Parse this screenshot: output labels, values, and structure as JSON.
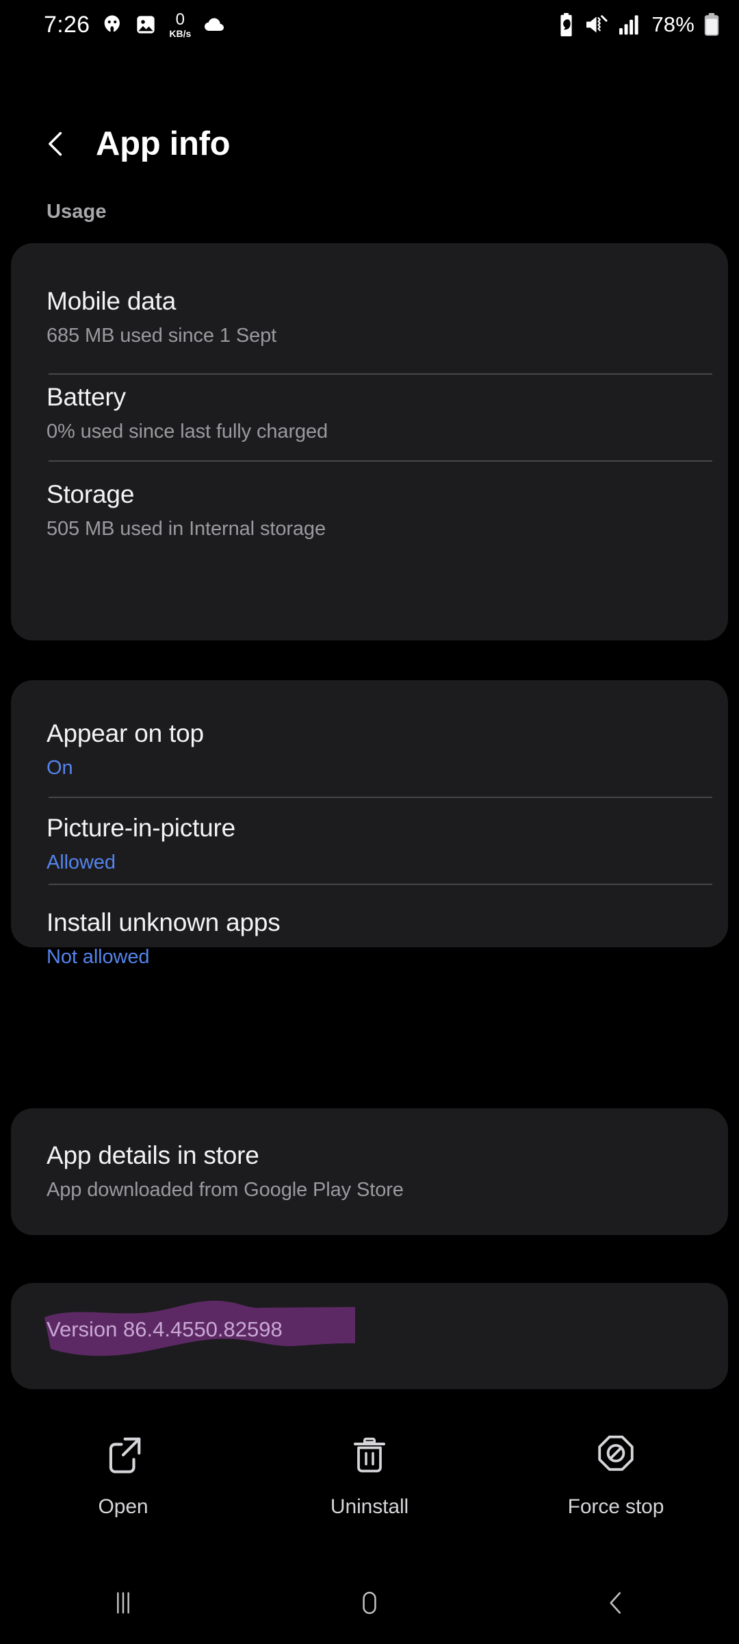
{
  "status_bar": {
    "time": "7:26",
    "network_speed_value": "0",
    "network_speed_unit": "KB/s",
    "battery_percent": "78%",
    "left_icons": [
      "malwarebytes-icon",
      "gallery-image-icon",
      "network-speed-indicator",
      "cloud-icon"
    ],
    "right_icons": [
      "battery-saver-icon",
      "mute-vibrate-icon",
      "signal-bars-icon",
      "battery-icon"
    ]
  },
  "header": {
    "title": "App info",
    "back_label": "Back"
  },
  "sections": [
    {
      "label": "Usage",
      "rows": [
        {
          "title": "Mobile data",
          "subtitle": "685 MB used since 1 Sept",
          "accent": false
        },
        {
          "title": "Battery",
          "subtitle": "0% used since last fully charged",
          "accent": false
        },
        {
          "title": "Storage",
          "subtitle": "505 MB used in Internal storage",
          "accent": false
        }
      ]
    },
    {
      "label": "",
      "rows": [
        {
          "title": "Appear on top",
          "subtitle": "On",
          "accent": true
        },
        {
          "title": "Picture-in-picture",
          "subtitle": "Allowed",
          "accent": true
        },
        {
          "title": "Install unknown apps",
          "subtitle": "Not allowed",
          "accent": true
        }
      ]
    },
    {
      "label": "",
      "rows": [
        {
          "title": "App details in store",
          "subtitle": "App downloaded from Google Play Store",
          "accent": false
        }
      ]
    }
  ],
  "version": {
    "text": "Version 86.4.4550.82598",
    "highlighted": true,
    "highlight_color": "#5d2965"
  },
  "actions": [
    {
      "label": "Open",
      "icon": "external-link-icon"
    },
    {
      "label": "Uninstall",
      "icon": "trash-icon"
    },
    {
      "label": "Force stop",
      "icon": "force-stop-icon"
    }
  ],
  "navigation_bar": [
    {
      "name": "recents",
      "icon": "recents-icon"
    },
    {
      "name": "home",
      "icon": "home-icon"
    },
    {
      "name": "back",
      "icon": "back-icon"
    }
  ],
  "colors": {
    "background": "#000000",
    "card": "#1c1c1e",
    "accent_blue": "#5584ec",
    "primary_text": "#f3f3f5",
    "secondary_text": "#9b9b9f",
    "divider": "#47474a",
    "highlight_purple": "#5d2965"
  }
}
